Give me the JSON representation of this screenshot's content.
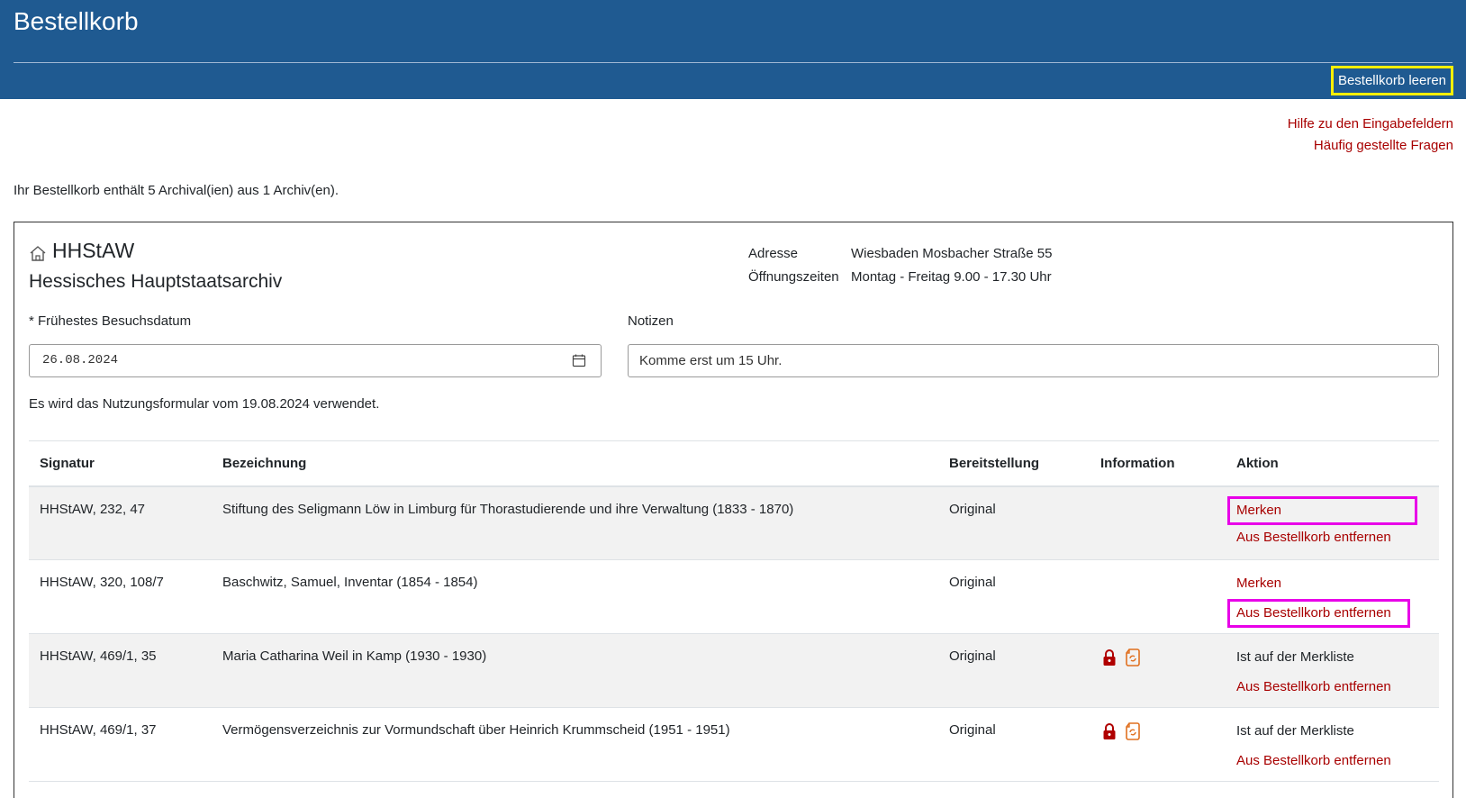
{
  "header": {
    "title": "Bestellkorb",
    "clear_button": "Bestellkorb leeren"
  },
  "help": {
    "input_help": "Hilfe zu den Eingabefeldern",
    "faq": "Häufig gestellte Fragen"
  },
  "summary": "Ihr Bestellkorb enthält 5 Archival(ien) aus 1 Archiv(en).",
  "archive": {
    "code": "HHStAW",
    "name": "Hessisches Hauptstaatsarchiv",
    "address_label": "Adresse",
    "address_value": "Wiesbaden Mosbacher Straße 55",
    "hours_label": "Öffnungszeiten",
    "hours_value": "Montag - Freitag 9.00 - 17.30 Uhr"
  },
  "form": {
    "date_label": "* Frühestes Besuchsdatum",
    "date_value": "26.08.2024",
    "notes_label": "Notizen",
    "notes_value": "Komme erst um 15 Uhr.",
    "usage_note": "Es wird das Nutzungsformular vom 19.08.2024 verwendet."
  },
  "table": {
    "headers": {
      "signatur": "Signatur",
      "bezeichnung": "Bezeichnung",
      "bereitstellung": "Bereitstellung",
      "information": "Information",
      "aktion": "Aktion"
    },
    "rows": [
      {
        "signatur": "HHStAW, 232, 47",
        "bezeichnung": "Stiftung des Seligmann Löw in Limburg für Thorastudierende und ihre Verwaltung (1833 - 1870)",
        "bereitstellung": "Original",
        "action_first": "Merken",
        "action_second": "Aus Bestellkorb entfernen"
      },
      {
        "signatur": "HHStAW, 320, 108/7",
        "bezeichnung": "Baschwitz, Samuel, Inventar (1854 - 1854)",
        "bereitstellung": "Original",
        "action_first": "Merken",
        "action_second": "Aus Bestellkorb entfernen"
      },
      {
        "signatur": "HHStAW, 469/1, 35",
        "bezeichnung": "Maria Catharina Weil in Kamp (1930 - 1930)",
        "bereitstellung": "Original",
        "action_first": "Ist auf der Merkliste",
        "action_second": "Aus Bestellkorb entfernen"
      },
      {
        "signatur": "HHStAW, 469/1, 37",
        "bezeichnung": "Vermögensverzeichnis zur Vormundschaft über Heinrich Krummscheid (1951 - 1951)",
        "bereitstellung": "Original",
        "action_first": "Ist auf der Merkliste",
        "action_second": "Aus Bestellkorb entfernen"
      }
    ]
  },
  "colors": {
    "header_bg": "#1f5a91",
    "link": "#a80000",
    "highlight_yellow": "#ffef00",
    "highlight_magenta": "#e800e8",
    "lock_icon": "#b00000",
    "info_icon": "#e07020"
  }
}
